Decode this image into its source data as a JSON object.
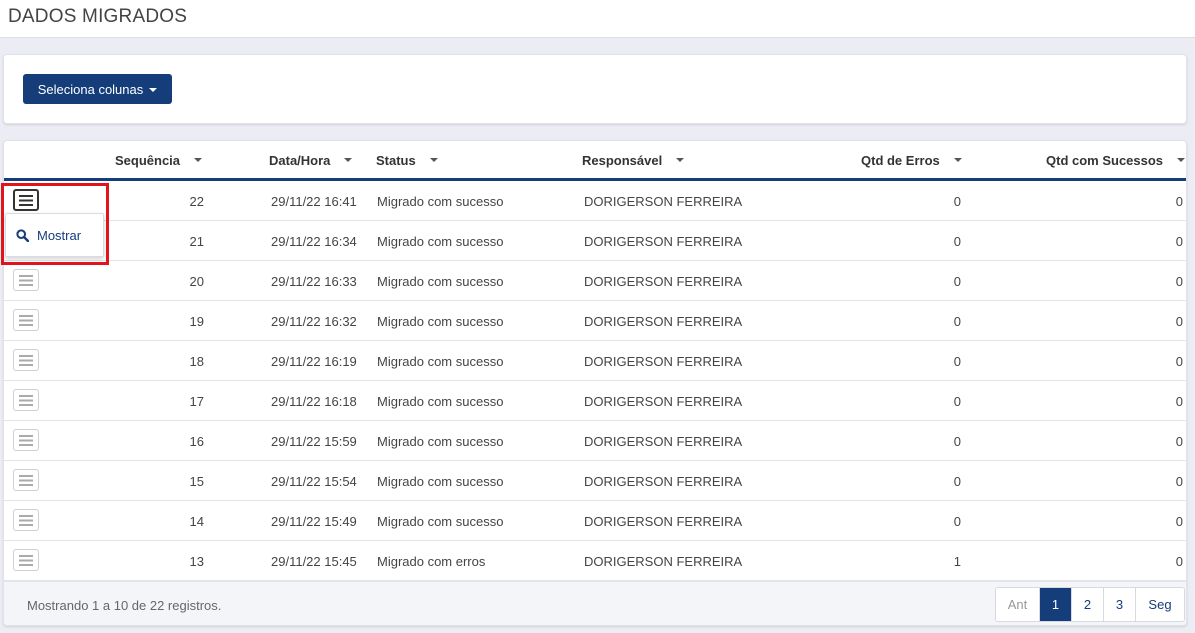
{
  "page": {
    "title": "DADOS MIGRADOS"
  },
  "toolbar": {
    "select_columns_label": "Seleciona colunas"
  },
  "table": {
    "columns": [
      "Sequência",
      "Data/Hora",
      "Status",
      "Responsável",
      "Qtd de Erros",
      "Qtd com Sucessos"
    ],
    "rows": [
      [
        "22",
        "29/11/22 16:41",
        "Migrado com sucesso",
        "DORIGERSON FERREIRA",
        "0",
        "0"
      ],
      [
        "21",
        "29/11/22 16:34",
        "Migrado com sucesso",
        "DORIGERSON FERREIRA",
        "0",
        "0"
      ],
      [
        "20",
        "29/11/22 16:33",
        "Migrado com sucesso",
        "DORIGERSON FERREIRA",
        "0",
        "0"
      ],
      [
        "19",
        "29/11/22 16:32",
        "Migrado com sucesso",
        "DORIGERSON FERREIRA",
        "0",
        "0"
      ],
      [
        "18",
        "29/11/22 16:19",
        "Migrado com sucesso",
        "DORIGERSON FERREIRA",
        "0",
        "0"
      ],
      [
        "17",
        "29/11/22 16:18",
        "Migrado com sucesso",
        "DORIGERSON FERREIRA",
        "0",
        "0"
      ],
      [
        "16",
        "29/11/22 15:59",
        "Migrado com sucesso",
        "DORIGERSON FERREIRA",
        "0",
        "0"
      ],
      [
        "15",
        "29/11/22 15:54",
        "Migrado com sucesso",
        "DORIGERSON FERREIRA",
        "0",
        "0"
      ],
      [
        "14",
        "29/11/22 15:49",
        "Migrado com sucesso",
        "DORIGERSON FERREIRA",
        "0",
        "0"
      ],
      [
        "13",
        "29/11/22 15:45",
        "Migrado com erros",
        "DORIGERSON FERREIRA",
        "1",
        "0"
      ]
    ]
  },
  "row_menu": {
    "show_label": "Mostrar",
    "icon": "search-icon"
  },
  "footer": {
    "summary": "Mostrando 1 a 10 de 22 registros.",
    "pagination": {
      "prev": "Ant",
      "pages": [
        "1",
        "2",
        "3"
      ],
      "next": "Seg",
      "current": "1"
    }
  },
  "colors": {
    "primary": "#153d7a",
    "highlight": "#e0141b",
    "background": "#ecedf4"
  }
}
